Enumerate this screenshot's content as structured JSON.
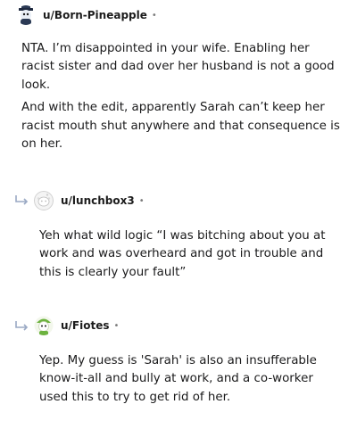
{
  "comments": [
    {
      "username": "u/Born-Pineapple",
      "meta_dot": "•",
      "avatar_icon": "pineapple-snoo-avatar-icon",
      "paragraphs": [
        "NTA. I’m disappointed in your wife. Enabling her racist sister and dad over her husband is not a good look.",
        "And with the edit, apparently Sarah can’t keep her racist mouth shut anywhere and that consequence is on her."
      ]
    },
    {
      "username": "u/lunchbox3",
      "meta_dot": "•",
      "avatar_icon": "default-snoo-avatar-icon",
      "reply_icon": "reply-arrow-icon",
      "paragraphs": [
        "Yeh what wild logic “I was bitching about you at work and was overheard and got in trouble and this is clearly your fault”"
      ]
    },
    {
      "username": "u/Fiotes",
      "meta_dot": "•",
      "avatar_icon": "green-snoo-avatar-icon",
      "reply_icon": "reply-arrow-icon",
      "paragraphs": [
        "Yep. My guess is 'Sarah' is also an insufferable know-it-all and bully at work, and a co-worker used this to try to get rid of her."
      ]
    }
  ],
  "colors": {
    "text": "#1a1a1b",
    "meta": "#7c7c7c",
    "reply_arrow": "#9aa9c4"
  }
}
